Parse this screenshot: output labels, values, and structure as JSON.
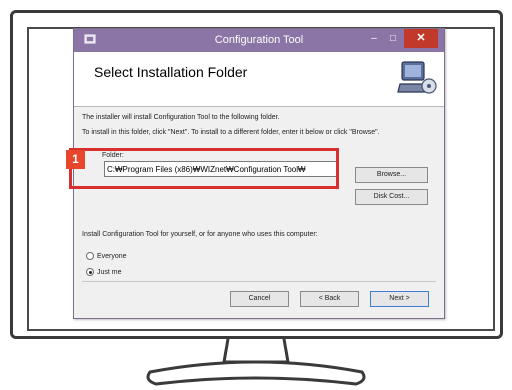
{
  "window": {
    "title": "Configuration Tool",
    "minimize_glyph": "–",
    "maximize_glyph": "□",
    "close_glyph": "✕"
  },
  "header": {
    "title": "Select Installation Folder"
  },
  "body": {
    "line1": "The installer will install Configuration Tool to the following folder.",
    "line2": "To install in this folder, click \"Next\". To install to a different folder, enter it below or click \"Browse\".",
    "folder_label": "Folder:",
    "folder_value": "C:₩Program Files (x86)₩WIZnet₩Configuration Tool₩",
    "browse_label": "Browse...",
    "disk_cost_label": "Disk Cost...",
    "install_for_text": "Install Configuration Tool for yourself, or for anyone who uses this computer:",
    "options": [
      {
        "label": "Everyone",
        "selected": false
      },
      {
        "label": "Just me",
        "selected": true
      }
    ]
  },
  "footer": {
    "cancel_label": "Cancel",
    "back_label": "< Back",
    "next_label": "Next >"
  },
  "callout": {
    "number": "1",
    "color": "#d7302f"
  },
  "colors": {
    "titlebar": "#8b74a6",
    "close_button": "#c0392b"
  }
}
